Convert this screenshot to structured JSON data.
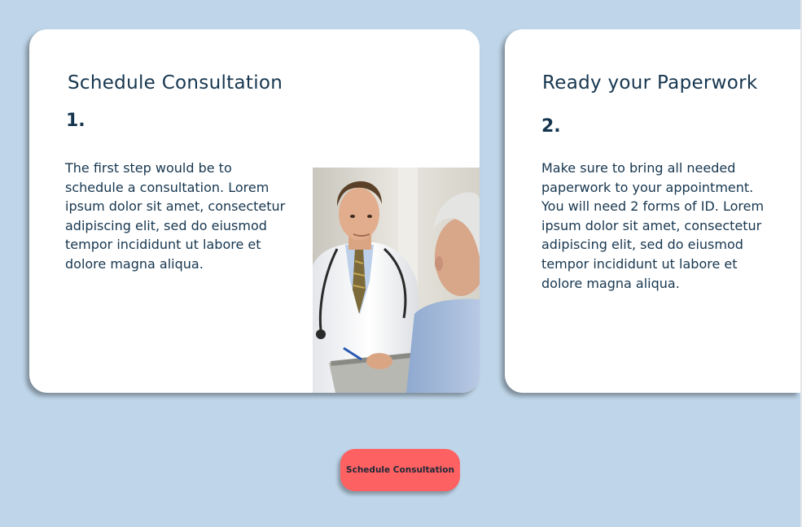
{
  "steps": [
    {
      "title": "Schedule Consultation",
      "number": "1.",
      "body": "The first step would be to schedule a consultation. Lorem ipsum dolor sit amet, consectetur adipiscing elit, sed do eiusmod tempor incididunt ut labore et dolore magna aliqua."
    },
    {
      "title": "Ready your Paperwork",
      "number": "2.",
      "body": "Make sure to bring all needed paperwork to your appointment. You will need 2 forms of ID. Lorem ipsum dolor sit amet, consectetur adipiscing elit, sed do eiusmod tempor incididunt ut labore et dolore magna aliqua."
    }
  ],
  "cta": {
    "label": "Schedule Consultation",
    "color": "#fe6161"
  },
  "colors": {
    "background": "#bfd6ea",
    "card": "#ffffff",
    "text": "#16364f"
  }
}
